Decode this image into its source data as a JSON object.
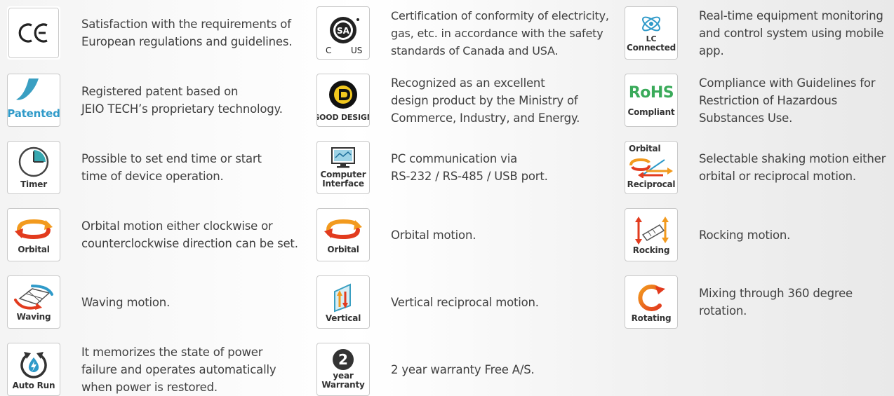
{
  "columns": [
    {
      "items": [
        {
          "badge": "",
          "lines": [
            "Satisfaction with the requirements of",
            "European regulations and guidelines."
          ]
        },
        {
          "badge": "Patented",
          "lines": [
            "Registered patent based on",
            "JEIO TECH’s proprietary technology."
          ]
        },
        {
          "badge": "Timer",
          "lines": [
            "Possible to set end time or start",
            "time of device operation."
          ]
        },
        {
          "badge": "Orbital",
          "lines": [
            "Orbital motion either clockwise or",
            "counterclockwise direction can be set."
          ]
        },
        {
          "badge": "Waving",
          "lines": [
            "Waving motion."
          ]
        },
        {
          "badge": "Auto Run",
          "lines": [
            "It memorizes the state of power",
            "failure and operates automatically",
            "when power is restored."
          ]
        }
      ]
    },
    {
      "items": [
        {
          "badge": "",
          "lines": [
            "Certification of conformity of electricity,",
            "gas, etc. in accordance with the safety",
            "standards of Canada and USA."
          ]
        },
        {
          "badge": "GOOD DESIGN",
          "lines": [
            "Recognized as an excellent",
            "design product by the Ministry of",
            "Commerce, Industry, and Energy."
          ]
        },
        {
          "badge_line1": "Computer",
          "badge_line2": "Interface",
          "lines": [
            "PC communication via",
            "RS-232 / RS-485 / USB port."
          ]
        },
        {
          "badge": "Orbital",
          "lines": [
            "Orbital motion."
          ]
        },
        {
          "badge": "Vertical",
          "lines": [
            "Vertical reciprocal motion."
          ]
        },
        {
          "badge_number": "2",
          "badge_line1": "year",
          "badge_line2": "Warranty",
          "lines": [
            "2 year warranty Free A/S."
          ]
        }
      ]
    },
    {
      "items": [
        {
          "badge_line1": "LC",
          "badge_line2": "Connected",
          "lines": [
            "Real-time equipment monitoring",
            "and control system using mobile",
            "app."
          ]
        },
        {
          "badge": "Compliant",
          "lines": [
            "Compliance with Guidelines for",
            "Restriction of Hazardous",
            "Substances Use."
          ]
        },
        {
          "badge_line1": "Orbital",
          "badge_line2": "Reciprocal",
          "lines": [
            "Selectable shaking motion either",
            "orbital or reciprocal motion."
          ]
        },
        {
          "badge": "Rocking",
          "lines": [
            "Rocking motion."
          ]
        },
        {
          "badge": "Rotating",
          "lines": [
            "Mixing through 360 degree",
            "rotation."
          ]
        }
      ]
    }
  ],
  "logos": {
    "ce": "CE",
    "csa_left": "C",
    "csa_right": "US",
    "csa_center": "SA",
    "rohs": "RoHS"
  },
  "colors": {
    "orange": "#f29a1e",
    "red": "#e23b1e",
    "teal": "#35a7b0",
    "blue": "#2f9ac9",
    "green": "#3aaa5a"
  }
}
